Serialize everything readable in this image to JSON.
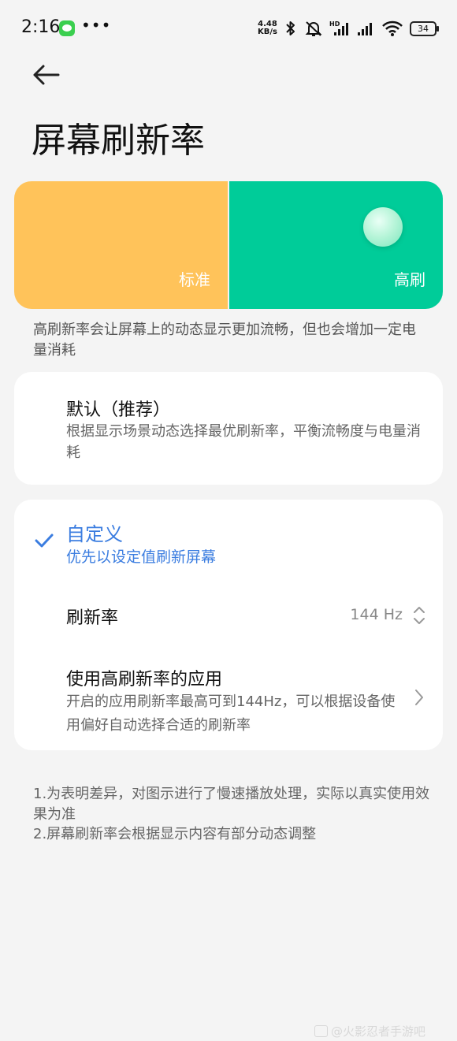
{
  "status_bar": {
    "time": "2:16",
    "more": "•••",
    "net_speed_value": "4.48",
    "net_speed_unit": "KB/s",
    "battery": "34",
    "icons": [
      "message-app-icon",
      "bluetooth-icon",
      "mute-icon",
      "hd-signal-icon",
      "signal-icon",
      "wifi-icon",
      "battery-icon"
    ]
  },
  "page": {
    "title": "屏幕刷新率"
  },
  "mode_selector": {
    "standard_label": "标准",
    "high_label": "高刷",
    "selected": "high",
    "colors": {
      "standard": "#ffc35a",
      "high": "#00cc99"
    },
    "description": "高刷新率会让屏幕上的动态显示更加流畅，但也会增加一定电量消耗"
  },
  "option_default": {
    "title": "默认（推荐）",
    "subtitle": "根据显示场景动态选择最优刷新率，平衡流畅度与电量消耗"
  },
  "option_custom": {
    "title": "自定义",
    "subtitle": "优先以设定值刷新屏幕",
    "checked": true,
    "accent_color": "#3b7de0"
  },
  "refresh_rate": {
    "label": "刷新率",
    "value": "144 Hz"
  },
  "high_refresh_apps": {
    "title": "使用高刷新率的应用",
    "subtitle": "开启的应用刷新率最高可到144Hz，可以根据设备使用偏好自动选择合适的刷新率"
  },
  "footnotes": [
    "1.为表明差异，对图示进行了慢速播放处理，实际以真实使用效果为准",
    "2.屏幕刷新率会根据显示内容有部分动态调整"
  ],
  "watermark": "@火影忍者手游吧"
}
